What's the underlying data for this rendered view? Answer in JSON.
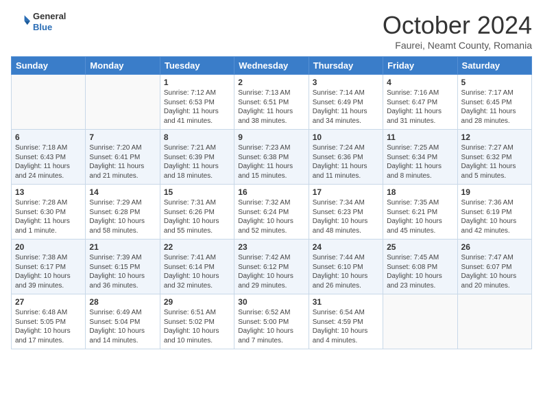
{
  "header": {
    "logo_general": "General",
    "logo_blue": "Blue",
    "month_title": "October 2024",
    "location": "Faurei, Neamt County, Romania"
  },
  "days_of_week": [
    "Sunday",
    "Monday",
    "Tuesday",
    "Wednesday",
    "Thursday",
    "Friday",
    "Saturday"
  ],
  "weeks": [
    [
      {
        "day": "",
        "info": ""
      },
      {
        "day": "",
        "info": ""
      },
      {
        "day": "1",
        "info": "Sunrise: 7:12 AM\nSunset: 6:53 PM\nDaylight: 11 hours and 41 minutes."
      },
      {
        "day": "2",
        "info": "Sunrise: 7:13 AM\nSunset: 6:51 PM\nDaylight: 11 hours and 38 minutes."
      },
      {
        "day": "3",
        "info": "Sunrise: 7:14 AM\nSunset: 6:49 PM\nDaylight: 11 hours and 34 minutes."
      },
      {
        "day": "4",
        "info": "Sunrise: 7:16 AM\nSunset: 6:47 PM\nDaylight: 11 hours and 31 minutes."
      },
      {
        "day": "5",
        "info": "Sunrise: 7:17 AM\nSunset: 6:45 PM\nDaylight: 11 hours and 28 minutes."
      }
    ],
    [
      {
        "day": "6",
        "info": "Sunrise: 7:18 AM\nSunset: 6:43 PM\nDaylight: 11 hours and 24 minutes."
      },
      {
        "day": "7",
        "info": "Sunrise: 7:20 AM\nSunset: 6:41 PM\nDaylight: 11 hours and 21 minutes."
      },
      {
        "day": "8",
        "info": "Sunrise: 7:21 AM\nSunset: 6:39 PM\nDaylight: 11 hours and 18 minutes."
      },
      {
        "day": "9",
        "info": "Sunrise: 7:23 AM\nSunset: 6:38 PM\nDaylight: 11 hours and 15 minutes."
      },
      {
        "day": "10",
        "info": "Sunrise: 7:24 AM\nSunset: 6:36 PM\nDaylight: 11 hours and 11 minutes."
      },
      {
        "day": "11",
        "info": "Sunrise: 7:25 AM\nSunset: 6:34 PM\nDaylight: 11 hours and 8 minutes."
      },
      {
        "day": "12",
        "info": "Sunrise: 7:27 AM\nSunset: 6:32 PM\nDaylight: 11 hours and 5 minutes."
      }
    ],
    [
      {
        "day": "13",
        "info": "Sunrise: 7:28 AM\nSunset: 6:30 PM\nDaylight: 11 hours and 1 minute."
      },
      {
        "day": "14",
        "info": "Sunrise: 7:29 AM\nSunset: 6:28 PM\nDaylight: 10 hours and 58 minutes."
      },
      {
        "day": "15",
        "info": "Sunrise: 7:31 AM\nSunset: 6:26 PM\nDaylight: 10 hours and 55 minutes."
      },
      {
        "day": "16",
        "info": "Sunrise: 7:32 AM\nSunset: 6:24 PM\nDaylight: 10 hours and 52 minutes."
      },
      {
        "day": "17",
        "info": "Sunrise: 7:34 AM\nSunset: 6:23 PM\nDaylight: 10 hours and 48 minutes."
      },
      {
        "day": "18",
        "info": "Sunrise: 7:35 AM\nSunset: 6:21 PM\nDaylight: 10 hours and 45 minutes."
      },
      {
        "day": "19",
        "info": "Sunrise: 7:36 AM\nSunset: 6:19 PM\nDaylight: 10 hours and 42 minutes."
      }
    ],
    [
      {
        "day": "20",
        "info": "Sunrise: 7:38 AM\nSunset: 6:17 PM\nDaylight: 10 hours and 39 minutes."
      },
      {
        "day": "21",
        "info": "Sunrise: 7:39 AM\nSunset: 6:15 PM\nDaylight: 10 hours and 36 minutes."
      },
      {
        "day": "22",
        "info": "Sunrise: 7:41 AM\nSunset: 6:14 PM\nDaylight: 10 hours and 32 minutes."
      },
      {
        "day": "23",
        "info": "Sunrise: 7:42 AM\nSunset: 6:12 PM\nDaylight: 10 hours and 29 minutes."
      },
      {
        "day": "24",
        "info": "Sunrise: 7:44 AM\nSunset: 6:10 PM\nDaylight: 10 hours and 26 minutes."
      },
      {
        "day": "25",
        "info": "Sunrise: 7:45 AM\nSunset: 6:08 PM\nDaylight: 10 hours and 23 minutes."
      },
      {
        "day": "26",
        "info": "Sunrise: 7:47 AM\nSunset: 6:07 PM\nDaylight: 10 hours and 20 minutes."
      }
    ],
    [
      {
        "day": "27",
        "info": "Sunrise: 6:48 AM\nSunset: 5:05 PM\nDaylight: 10 hours and 17 minutes."
      },
      {
        "day": "28",
        "info": "Sunrise: 6:49 AM\nSunset: 5:04 PM\nDaylight: 10 hours and 14 minutes."
      },
      {
        "day": "29",
        "info": "Sunrise: 6:51 AM\nSunset: 5:02 PM\nDaylight: 10 hours and 10 minutes."
      },
      {
        "day": "30",
        "info": "Sunrise: 6:52 AM\nSunset: 5:00 PM\nDaylight: 10 hours and 7 minutes."
      },
      {
        "day": "31",
        "info": "Sunrise: 6:54 AM\nSunset: 4:59 PM\nDaylight: 10 hours and 4 minutes."
      },
      {
        "day": "",
        "info": ""
      },
      {
        "day": "",
        "info": ""
      }
    ]
  ]
}
